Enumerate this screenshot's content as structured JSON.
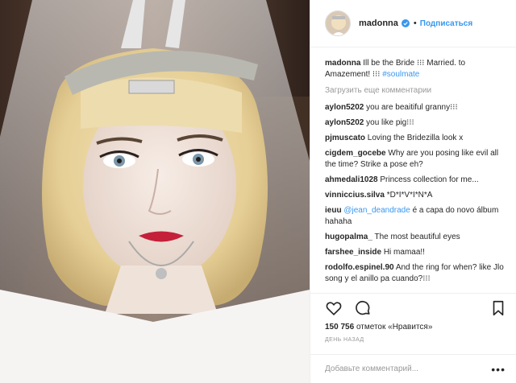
{
  "post_header": {
    "username": "madonna",
    "separator": "•",
    "follow_label": "Подписаться"
  },
  "caption": {
    "username": "madonna",
    "text": "Ill be the Bride ⁝⁝⁝ Married. to Amazement! ⁝⁝⁝",
    "hashtag": "#soulmate"
  },
  "load_more_label": "Загрузить еще комментарии",
  "comments": [
    {
      "user": "aylon5202",
      "text": "you are beaitiful granny⁝⁝⁝"
    },
    {
      "user": "aylon5202",
      "text": "you like pig⁝⁝⁝"
    },
    {
      "user": "pjmuscato",
      "text": "Loving the Bridezilla look x"
    },
    {
      "user": "cigdem_gocebe",
      "text": "Why are you posing like evil all the time? Strike a pose eh?"
    },
    {
      "user": "ahmedali1028",
      "text": "Princess collection for me..."
    },
    {
      "user": "vinniccius.silva",
      "text": "*D*I*V*I*N*A"
    },
    {
      "user": "ieuu",
      "mention": "@jean_deandrade",
      "text": "é a capa do novo álbum hahaha"
    },
    {
      "user": "hugopalma_",
      "text": "The most beautiful eyes"
    },
    {
      "user": "farshee_inside",
      "text": "Hi mamaa!!"
    },
    {
      "user": "rodolfo.espinel.90",
      "text": "And the ring for when? like Jlo song y el anillo pa cuando?⁝⁝⁝"
    }
  ],
  "likes": {
    "count": "150 756",
    "suffix": "отметок «Нравится»"
  },
  "time_ago": "ДЕНЬ НАЗАД",
  "add_comment_placeholder": "Добавьте комментарий...",
  "more_options": "•••",
  "icons": {
    "like": "heart-icon",
    "comment": "comment-icon",
    "save": "bookmark-icon",
    "verified": "verified-badge-icon"
  },
  "colors": {
    "accent": "#3897f0",
    "text": "#262626",
    "muted": "#999999"
  }
}
